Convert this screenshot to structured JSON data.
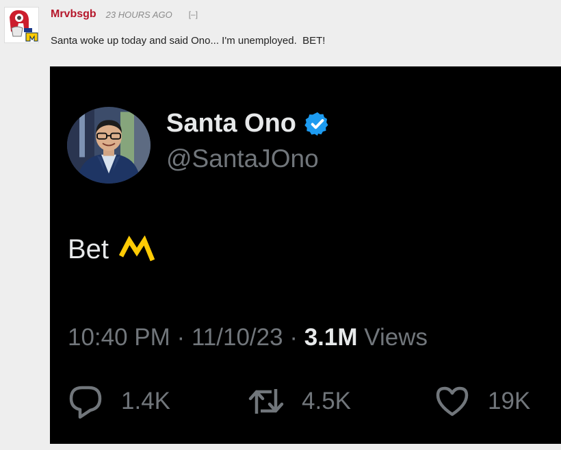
{
  "comment": {
    "username": "Mrvbsgb",
    "timestamp": "23 HOURS AGO",
    "collapse_label": "[–]",
    "text": "Santa woke up today and said Ono... I'm unemployed.  BET!"
  },
  "tweet": {
    "display_name": "Santa Ono",
    "handle": "@SantaJOno",
    "text": "Bet",
    "time": "10:40 PM",
    "date": "11/10/23",
    "separator": "·",
    "views_count": "3.1M",
    "views_label": "Views",
    "replies": "1.4K",
    "retweets": "4.5K",
    "likes": "19K"
  },
  "colors": {
    "username": "#b5172b",
    "verified": "#1d9bf0",
    "maize": "#ffcb05",
    "embed_background": "#000000",
    "muted_text": "#71767b",
    "bright_text": "#e7e9ea"
  },
  "icons": {
    "avatar": "michigan-logo-avatar",
    "verified": "verified-badge-icon",
    "emoji": "block-m-icon",
    "reply": "reply-bubble-icon",
    "retweet": "retweet-icon",
    "like": "heart-icon"
  }
}
